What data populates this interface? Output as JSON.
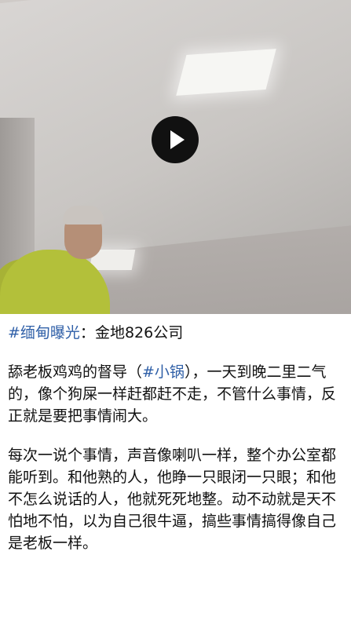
{
  "header_line": {
    "hashtag": "#缅甸曝光",
    "colon": "：",
    "company": "金地826公司"
  },
  "paragraph1": {
    "before": "舔老板鸡鸡的督导（",
    "hashtag": "#小锅",
    "after": "），一天到晚二里二气的，像个狗屎一样赶都赶不走，不管什么事情，反正就是要把事情闹大。"
  },
  "paragraph2": {
    "text": "每次一说个事情，声音像喇叭一样，整个办公室都能听到。和他熟的人，他睁一只眼闭一只眼；和他不怎么说话的人，他就死死地整。动不动就是天不怕地不怕，以为自己很牛逼，搞些事情搞得像自己是老板一样。"
  },
  "video": {
    "play_icon": "play-icon",
    "button_color": "#111111",
    "shirt_color": "#b3c03a"
  },
  "colors": {
    "hashtag": "#3060a8",
    "text": "#111111"
  }
}
